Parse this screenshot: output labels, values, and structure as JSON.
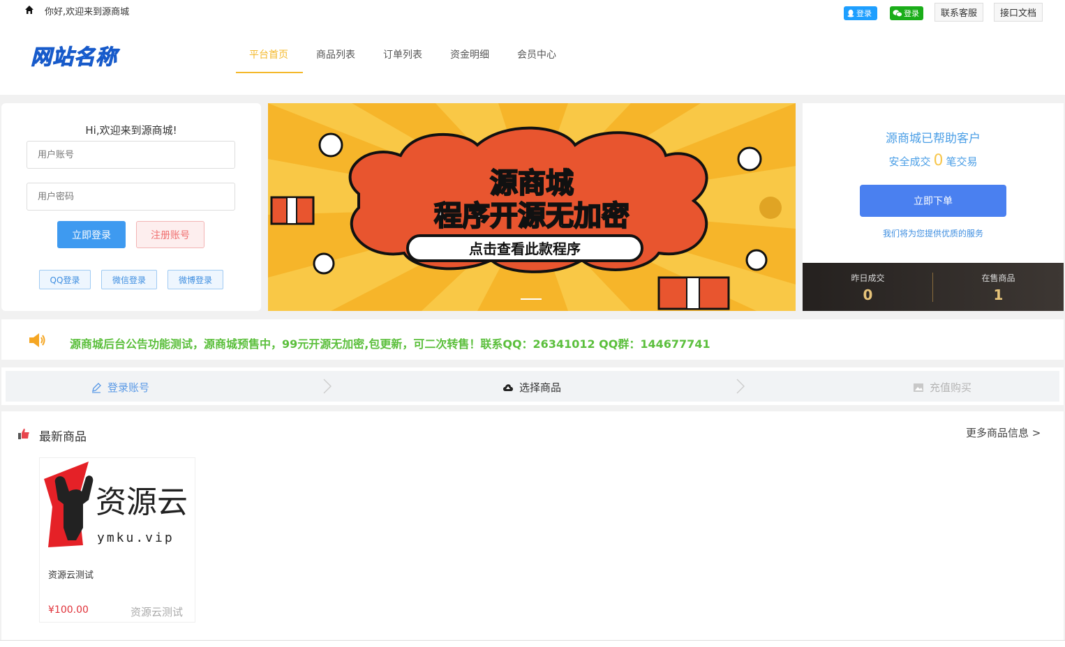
{
  "top_bar": {
    "welcome": "你好,欢迎来到源商城",
    "qq_login": "登录",
    "wechat_login": "登录",
    "contact": "联系客服",
    "api_doc": "接口文档"
  },
  "logo_text": "网站名称",
  "nav": [
    "平台首页",
    "商品列表",
    "订单列表",
    "资金明细",
    "会员中心"
  ],
  "login": {
    "greeting": "Hi,欢迎来到源商城!",
    "user_placeholder": "用户账号",
    "pass_placeholder": "用户密码",
    "login_button": "立即登录",
    "register_button": "注册账号",
    "qq": "QQ登录",
    "wechat": "微信登录",
    "weibo": "微博登录"
  },
  "banner": {
    "title": "源商城",
    "subtitle": "程序开源无加密",
    "cta": "点击查看此款程序"
  },
  "stats": {
    "line1": "源商城已帮助客户",
    "line2_prefix": "安全成交",
    "count": "0",
    "line2_suffix": "笔交易",
    "order_button": "立即下单",
    "service": "我们将为您提供优质的服务",
    "yesterday_label": "昨日成交",
    "yesterday_value": "0",
    "onsale_label": "在售商品",
    "onsale_value": "1"
  },
  "notice": "源商城后台公告功能测试，源商城预售中，99元开源无加密,包更新，可二次转售！联系QQ：26341012 QQ群：144677741",
  "steps": [
    "登录账号",
    "选择商品",
    "充值购买"
  ],
  "products": {
    "title": "最新商品",
    "more": "更多商品信息 >",
    "items": [
      {
        "image_text": "资源云",
        "image_url_text": "ymku.vip",
        "name": "资源云测试",
        "price": "¥100.00",
        "tag": "资源云测试"
      }
    ]
  },
  "colors": {
    "accent": "#f4b82a",
    "primary": "#4a80f0",
    "notice_green": "#5bbf3c"
  }
}
